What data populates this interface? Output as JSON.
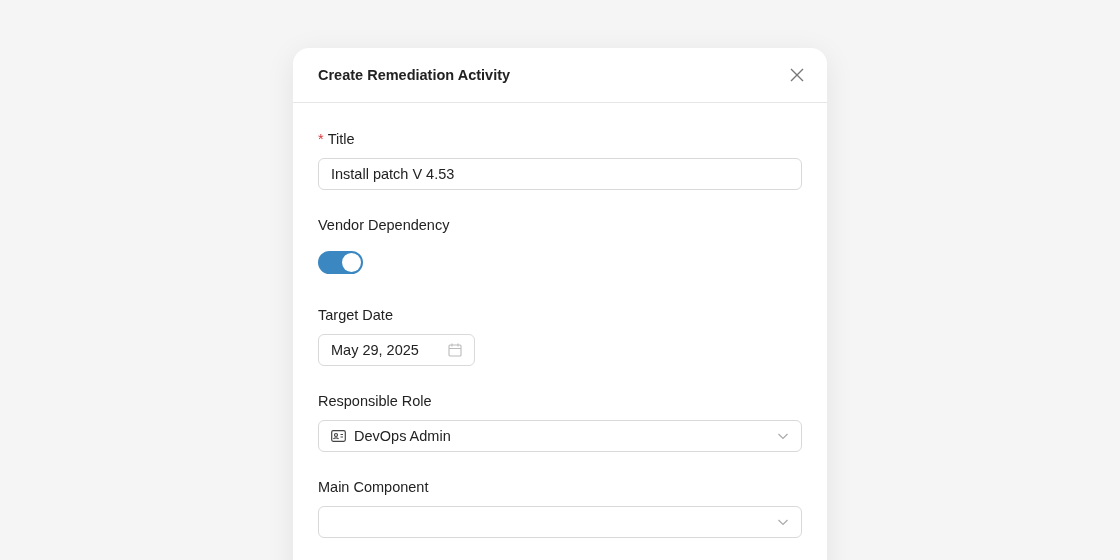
{
  "dialog": {
    "title": "Create Remediation Activity",
    "fields": [
      {
        "kind": "text",
        "label": "Title",
        "required_mark": "*",
        "value": "Install patch V 4.53"
      },
      {
        "kind": "switch",
        "label": "Vendor Dependency",
        "on": true
      },
      {
        "kind": "date",
        "label": "Target Date",
        "value": "May 29, 2025"
      },
      {
        "kind": "select",
        "label": "Responsible Role",
        "value": "DevOps Admin",
        "has_icon": true
      },
      {
        "kind": "select",
        "label": "Main Component"
      }
    ]
  }
}
